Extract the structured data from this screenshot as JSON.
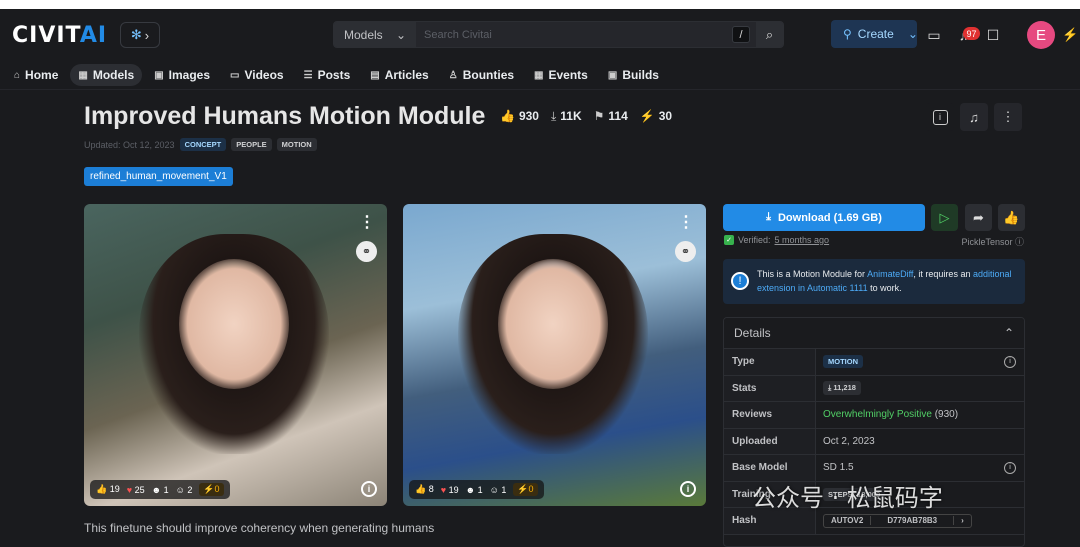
{
  "header": {
    "logo_main": "CIVIT",
    "logo_ai": "AI",
    "search": {
      "category": "Models",
      "placeholder": "Search Civitai",
      "shortcut": "/"
    },
    "create_label": "Create",
    "notification_count": "97",
    "avatar_letter": "E"
  },
  "nav": {
    "items": [
      {
        "label": "Home",
        "icon": "home-icon"
      },
      {
        "label": "Models",
        "icon": "grid-icon"
      },
      {
        "label": "Images",
        "icon": "image-icon"
      },
      {
        "label": "Videos",
        "icon": "video-icon"
      },
      {
        "label": "Posts",
        "icon": "posts-icon"
      },
      {
        "label": "Articles",
        "icon": "article-icon"
      },
      {
        "label": "Bounties",
        "icon": "bounty-icon"
      },
      {
        "label": "Events",
        "icon": "calendar-icon"
      },
      {
        "label": "Builds",
        "icon": "builds-icon"
      }
    ],
    "active": "Models"
  },
  "model": {
    "title": "Improved Humans Motion Module",
    "stats": {
      "likes": "930",
      "downloads": "11K",
      "saves": "114",
      "buzz": "30"
    },
    "updated": "Updated: Oct 12, 2023",
    "tags": [
      "CONCEPT",
      "PEOPLE",
      "MOTION"
    ],
    "version": "refined_human_movement_V1",
    "description": "This finetune should improve coherency when generating humans"
  },
  "gallery": [
    {
      "reactions": {
        "like": "19",
        "heart": "25",
        "laugh": "1",
        "cry": "2",
        "buzz": "0"
      }
    },
    {
      "reactions": {
        "like": "8",
        "heart": "19",
        "laugh": "1",
        "cry": "1",
        "buzz": "0"
      }
    }
  ],
  "sidebar": {
    "download_label": "Download (1.69 GB)",
    "verified_prefix": "Verified:",
    "verified_time": "5 months ago",
    "format": "PickleTensor",
    "notice": {
      "text1": "This is a Motion Module for ",
      "link1": "AnimateDiff",
      "text2": ", it requires an ",
      "link2": "additional extension in Automatic 1111",
      "text3": " to work."
    },
    "details_title": "Details",
    "details": {
      "type_label": "Type",
      "type_value": "MOTION",
      "stats_label": "Stats",
      "stats_value": "11,218",
      "reviews_label": "Reviews",
      "reviews_value": "Overwhelmingly Positive",
      "reviews_count": "(930)",
      "uploaded_label": "Uploaded",
      "uploaded_value": "Oct 2, 2023",
      "base_label": "Base Model",
      "base_value": "SD 1.5",
      "training_label": "Training",
      "training_value": "STEPS: 18,000",
      "hash_label": "Hash",
      "hash_algo": "AUTOV2",
      "hash_value": "D779AB78B3"
    }
  },
  "watermark": "公众号 · 松鼠码字",
  "colors": {
    "accent": "#228be6",
    "background": "#1a1b1e",
    "buzz": "#fab005",
    "positive": "#51cf66"
  }
}
